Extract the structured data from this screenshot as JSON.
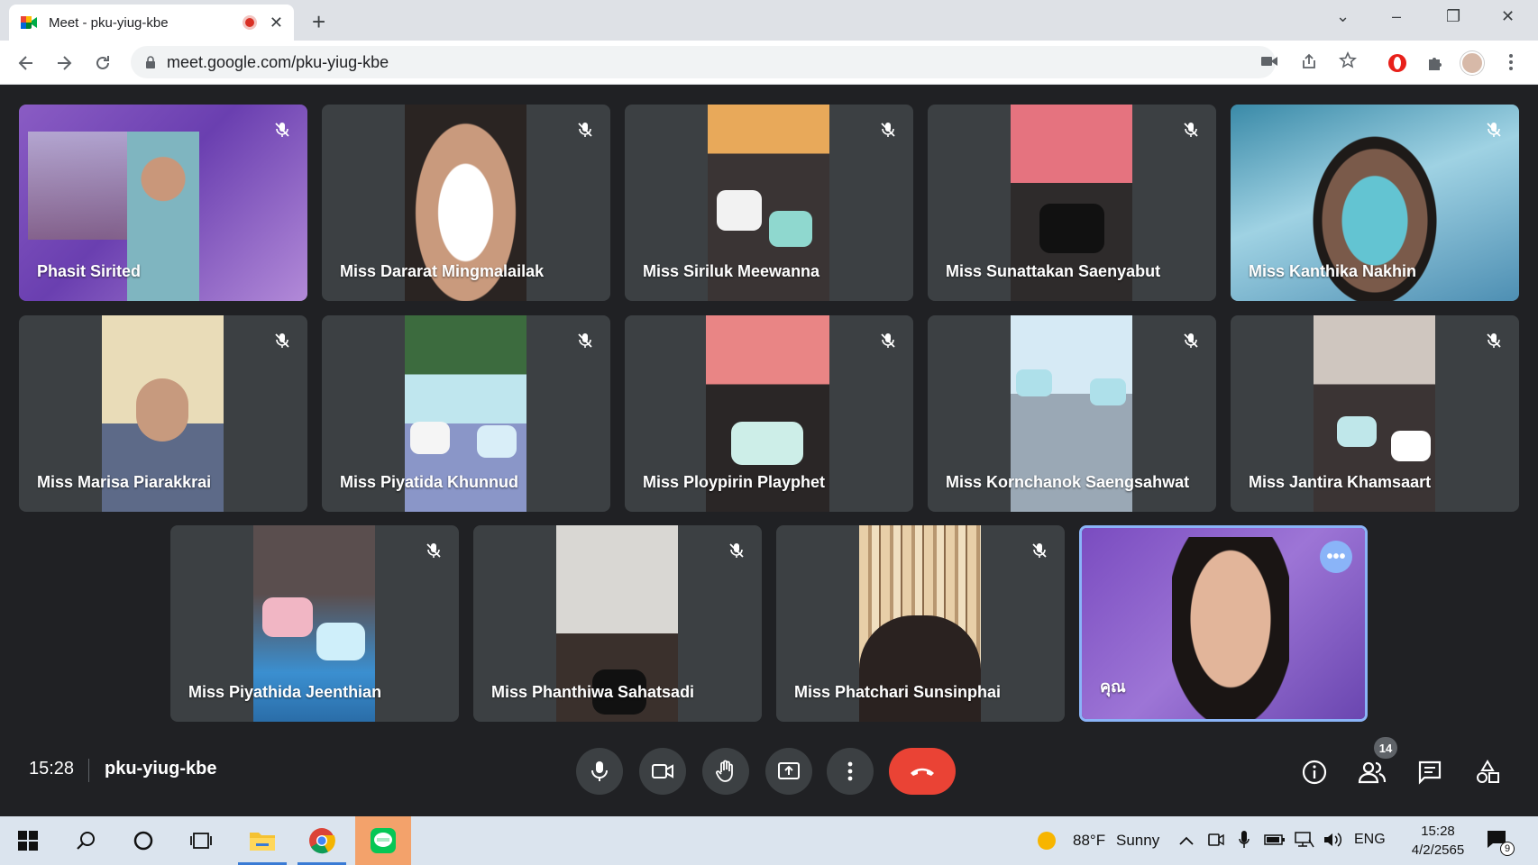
{
  "browser": {
    "tab_title": "Meet - pku-yiug-kbe",
    "tab_close": "✕",
    "new_tab": "+",
    "url": "meet.google.com/pku-yiug-kbe",
    "window_controls": [
      "⌄",
      "–",
      "❐",
      "✕"
    ]
  },
  "participants": [
    {
      "name": "Phasit Sirited"
    },
    {
      "name": "Miss Dararat Mingmalailak"
    },
    {
      "name": "Miss Siriluk Meewanna"
    },
    {
      "name": "Miss Sunattakan Saenyabut"
    },
    {
      "name": "Miss Kanthika Nakhin"
    },
    {
      "name": "Miss Marisa Piarakkrai"
    },
    {
      "name": "Miss Piyatida Khunnud"
    },
    {
      "name": "Miss Ploypirin Playphet"
    },
    {
      "name": "Miss Kornchanok Saengsahwat"
    },
    {
      "name": "Miss Jantira Khamsaart"
    },
    {
      "name": "Miss Piyathida Jeenthian"
    },
    {
      "name": "Miss Phanthiwa Sahatsadi"
    },
    {
      "name": "Miss Phatchari Sunsinphai"
    },
    {
      "name": "คุณ"
    }
  ],
  "meeting": {
    "time": "15:28",
    "code": "pku-yiug-kbe",
    "people_count": "14",
    "more_dots": "•••"
  },
  "taskbar": {
    "weather_temp": "88°F",
    "weather_text": "Sunny",
    "language": "ENG",
    "time": "15:28",
    "date": "4/2/2565",
    "notification_count": "9"
  },
  "colors": {
    "meet_background": "#202124",
    "tile_background": "#3c4043",
    "leave_button": "#ea4335",
    "self_border": "#8ab4f8"
  }
}
